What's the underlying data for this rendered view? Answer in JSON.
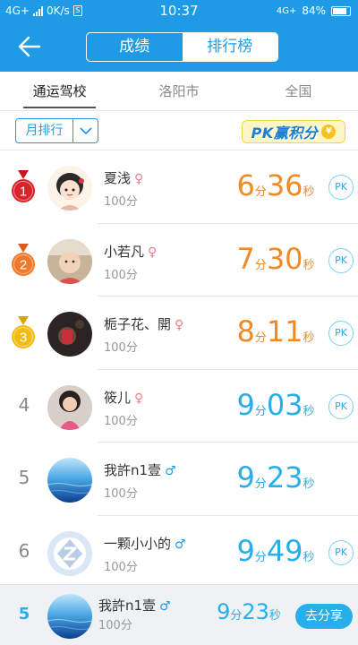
{
  "status_bar": {
    "network_left": "4G+",
    "speed": "0K/s",
    "time": "10:37",
    "network_right": "4G+",
    "battery": "84%"
  },
  "header": {
    "tabs": [
      {
        "label": "成绩",
        "active": false
      },
      {
        "label": "排行榜",
        "active": true
      }
    ]
  },
  "scope_tabs": [
    {
      "label": "通运驾校",
      "selected": true
    },
    {
      "label": "洛阳市",
      "selected": false
    },
    {
      "label": "全国",
      "selected": false
    }
  ],
  "filter": {
    "period_label": "月排行",
    "pk_banner": "PK赢积分",
    "pk_coin": "¥"
  },
  "rows": [
    {
      "rank": "1",
      "medal": "red",
      "name": "夏浅",
      "gender": "♀",
      "score": "100分",
      "min": "6",
      "min_unit": "分",
      "sec": "36",
      "sec_unit": "秒",
      "pk": "PK",
      "avatar": "girl-cartoon"
    },
    {
      "rank": "2",
      "medal": "orange",
      "name": "小若凡",
      "gender": "♀",
      "score": "100分",
      "min": "7",
      "min_unit": "分",
      "sec": "30",
      "sec_unit": "秒",
      "pk": "PK",
      "avatar": "baby"
    },
    {
      "rank": "3",
      "medal": "gold",
      "name": "栀子花、開",
      "gender": "♀",
      "score": "100分",
      "min": "8",
      "min_unit": "分",
      "sec": "11",
      "sec_unit": "秒",
      "pk": "PK",
      "avatar": "dark-photo"
    },
    {
      "rank": "4",
      "medal": "",
      "name": "筱儿",
      "gender": "♀",
      "score": "100分",
      "min": "9",
      "min_unit": "分",
      "sec": "03",
      "sec_unit": "秒",
      "pk": "PK",
      "avatar": "child"
    },
    {
      "rank": "5",
      "medal": "",
      "name": "我許n1壹",
      "gender": "♂",
      "score": "100分",
      "min": "9",
      "min_unit": "分",
      "sec": "23",
      "sec_unit": "秒",
      "pk": "",
      "avatar": "ocean"
    },
    {
      "rank": "6",
      "medal": "",
      "name": "一颗小小的",
      "gender": "♂",
      "score": "100分",
      "min": "9",
      "min_unit": "分",
      "sec": "49",
      "sec_unit": "秒",
      "pk": "PK",
      "avatar": "default-z"
    }
  ],
  "me": {
    "rank": "5",
    "name": "我許n1壹",
    "gender": "♂",
    "score": "100分",
    "min": "9",
    "min_unit": "分",
    "sec": "23",
    "sec_unit": "秒",
    "share_label": "去分享"
  },
  "colors": {
    "brand_blue": "#1f9be6",
    "time_orange": "#f08a24",
    "time_blue": "#28aee8",
    "female": "#e8808a",
    "male": "#1f9be6"
  }
}
